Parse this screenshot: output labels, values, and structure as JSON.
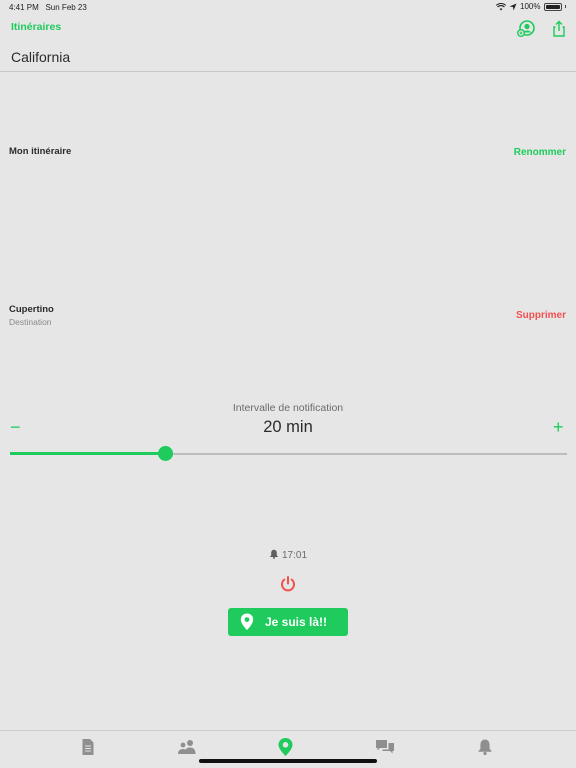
{
  "status_bar": {
    "time": "4:41 PM",
    "date": "Sun Feb 23",
    "battery": "100%"
  },
  "nav": {
    "back_label": "Itinéraires",
    "icons": [
      "user-circle-icon",
      "share-icon"
    ]
  },
  "page": {
    "title": "California"
  },
  "itinerary": {
    "name": "Mon itinéraire",
    "rename_label": "Renommer"
  },
  "destination": {
    "name": "Cupertino",
    "type_label": "Destination",
    "delete_label": "Supprimer"
  },
  "interval": {
    "title": "Intervalle de notification",
    "value_text": "20 min",
    "minus": "−",
    "plus": "+",
    "level": 0.28
  },
  "alarm": {
    "time": "17:01"
  },
  "cta": {
    "label": "Je suis là!!"
  },
  "tabbar": {
    "tabs": [
      "document-icon",
      "people-icon",
      "location-pin-icon",
      "chat-icon",
      "bell-icon"
    ],
    "active": 2
  },
  "colors": {
    "accent": "#1ecb5c",
    "danger": "#f0504f",
    "background": "#e6e6e6"
  }
}
